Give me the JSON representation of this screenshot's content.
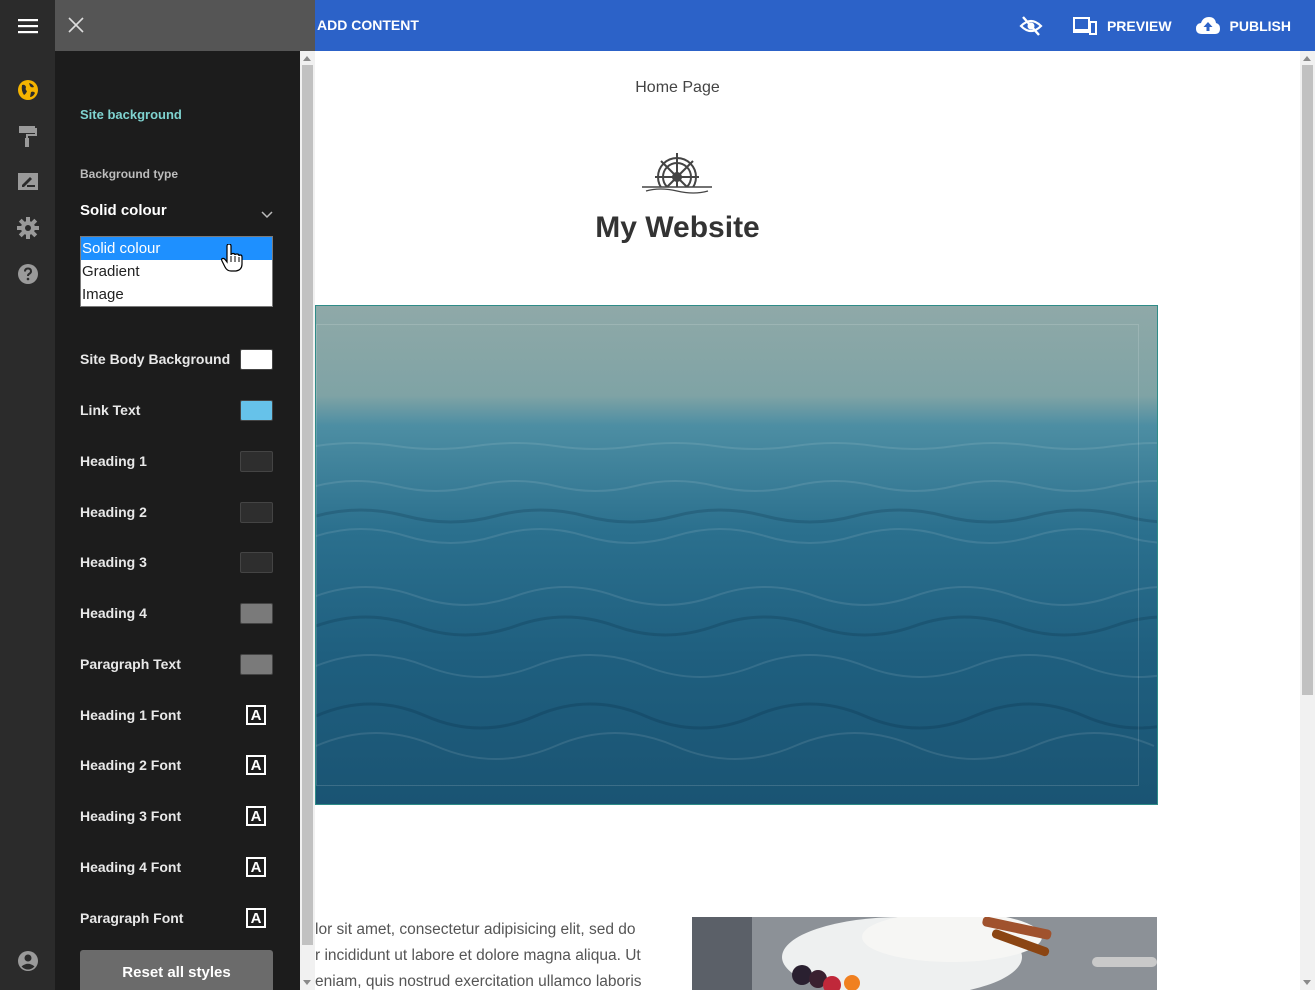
{
  "topbar": {
    "add_content": "ADD CONTENT",
    "preview": "PREVIEW",
    "publish": "PUBLISH",
    "visibility_icon": "eye-off-icon",
    "preview_icon": "devices-icon",
    "publish_icon": "cloud-upload-icon",
    "color": "#2c62c8"
  },
  "rail": {
    "items": [
      {
        "icon": "globe-icon",
        "active": true
      },
      {
        "icon": "paint-roller-icon"
      },
      {
        "icon": "edit-note-icon"
      },
      {
        "icon": "gear-icon"
      },
      {
        "icon": "help-icon"
      }
    ],
    "bottom_icon": "account-icon",
    "active_color": "#f5b400"
  },
  "panel": {
    "section_title": "Site background",
    "background_type_label": "Background type",
    "background_type_value": "Solid colour",
    "options": [
      "Solid colour",
      "Gradient",
      "Image"
    ],
    "rows": [
      {
        "label": "Site Body Background",
        "type": "color",
        "value": "#ffffff"
      },
      {
        "label": "Link Text",
        "type": "color",
        "value": "#66c2ea"
      },
      {
        "label": "Heading 1",
        "type": "color",
        "value": "#2e2e2e"
      },
      {
        "label": "Heading 2",
        "type": "color",
        "value": "#2e2e2e"
      },
      {
        "label": "Heading 3",
        "type": "color",
        "value": "#2e2e2e"
      },
      {
        "label": "Heading 4",
        "type": "color",
        "value": "#7a7a7a"
      },
      {
        "label": "Paragraph Text",
        "type": "color",
        "value": "#7a7a7a"
      },
      {
        "label": "Heading 1 Font",
        "type": "font",
        "value": "A"
      },
      {
        "label": "Heading 2 Font",
        "type": "font",
        "value": "A"
      },
      {
        "label": "Heading 3 Font",
        "type": "font",
        "value": "A"
      },
      {
        "label": "Heading 4 Font",
        "type": "font",
        "value": "A"
      },
      {
        "label": "Paragraph Font",
        "type": "font",
        "value": "A"
      }
    ],
    "reset_label": "Reset all styles"
  },
  "page": {
    "breadcrumb": "Home Page",
    "site_title": "My Website",
    "body_lines": [
      "lor sit amet, consectetur adipisicing elit, sed do",
      "r incididunt ut labore et dolore magna aliqua. Ut",
      "eniam, quis nostrud exercitation ullamco laboris"
    ]
  }
}
